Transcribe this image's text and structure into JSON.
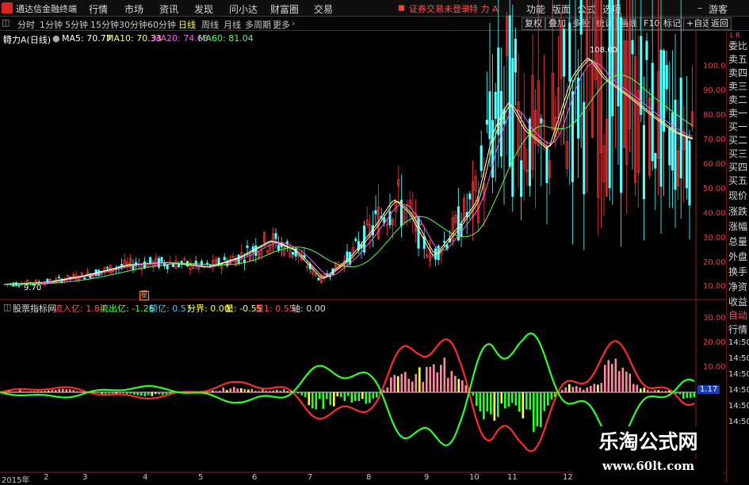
{
  "app": {
    "title": "通达信金融终端"
  },
  "menu": {
    "items": [
      "行情",
      "市场",
      "资讯",
      "发现",
      "问小达",
      "财富圈",
      "交易"
    ],
    "warning": "证券交易未登录",
    "stock": "特 力 A",
    "right_items": [
      "功能",
      "版面",
      "公式",
      "选项"
    ],
    "guest": "游客"
  },
  "periods": {
    "items": [
      "分时",
      "1分钟",
      "5分钟",
      "15分钟",
      "30分钟",
      "60分钟",
      "日线",
      "周线",
      "月线",
      "多周期",
      "更多"
    ],
    "active": "日线"
  },
  "toolbar_right": [
    "复权",
    "叠加",
    "多股",
    "统计",
    "画线",
    "F10",
    "标记",
    "+自选",
    "返回"
  ],
  "main_chart": {
    "stock_label": "特力A(日线)",
    "ma": [
      {
        "label": "MA5: 70.77",
        "color": "#ffffff"
      },
      {
        "label": "MA10: 70.33",
        "color": "#ffff54"
      },
      {
        "label": "MA20: 74.68",
        "color": "#ff54ff"
      },
      {
        "label": "MA60: 81.04",
        "color": "#54ff54"
      }
    ],
    "high_label": "108.00",
    "low_label": "9.70",
    "price_axis": [
      "100.0",
      "90.00",
      "80.00",
      "70.00",
      "60.00",
      "50.00",
      "40.00",
      "30.00",
      "20.00",
      "10.00"
    ],
    "marker": "星"
  },
  "indicator": {
    "name": "股票指标网",
    "values": [
      {
        "label": "流入亿: 1.84",
        "color": "#ff5050"
      },
      {
        "label": "流出亿: -1.26",
        "color": "#50ff50"
      },
      {
        "label": "额亿: 0.57",
        "color": "#50c8ff"
      },
      {
        "label": "分界: 0.00",
        "color": "#ffff54"
      },
      {
        "label": "量: -0.55",
        "color": "#ffff54"
      },
      {
        "label": "量1: 0.55",
        "color": "#ff5050"
      },
      {
        "label": "轴: 0.00",
        "color": "#dddddd"
      }
    ],
    "axis": [
      "30.00",
      "20.00",
      "10.00"
    ],
    "current": "1.17"
  },
  "sidebar": {
    "top": "L R",
    "items": [
      "委比",
      "卖五",
      "卖四",
      "卖三",
      "卖二",
      "卖一",
      "买一",
      "买二",
      "买三",
      "买四",
      "买五",
      "现价",
      "涨跌",
      "涨幅",
      "总量",
      "外盘",
      "换手",
      "净资",
      "收益"
    ],
    "lower": [
      "自动",
      "行情"
    ],
    "times": [
      "14:50",
      "14:50",
      "14:50",
      "14:50",
      "14:50",
      "14:50"
    ]
  },
  "dates": [
    "2015年",
    "2",
    "3",
    "4",
    "5",
    "6",
    "7",
    "8",
    "9",
    "10",
    "11",
    "12"
  ],
  "watermark": {
    "line1": "乐淘公式网",
    "line2": "www.60lt.com"
  },
  "colors": {
    "up": "#ff3c3c",
    "down": "#54ffff",
    "background": "#000000"
  }
}
